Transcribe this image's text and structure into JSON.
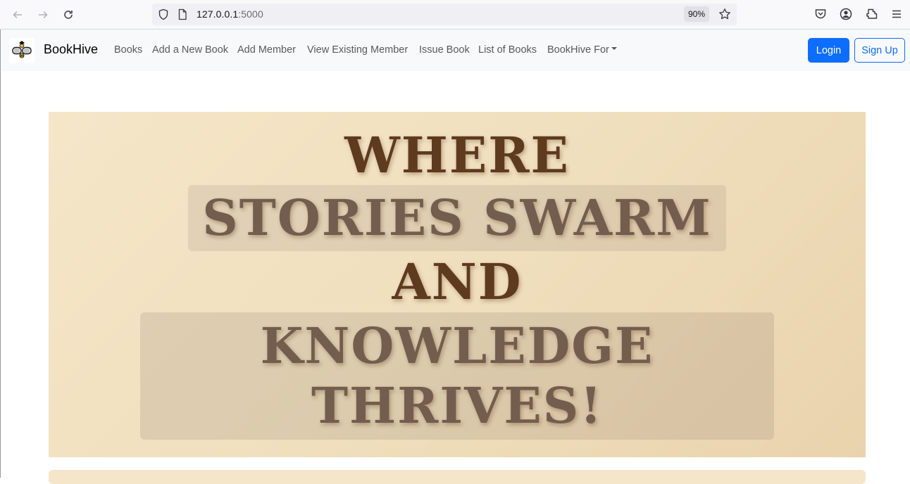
{
  "browser": {
    "url_host": "127.0.0.1",
    "url_port": ":5000",
    "zoom": "90%",
    "icons": [
      "back-icon",
      "forward-icon",
      "reload-icon",
      "shield-icon",
      "page-icon",
      "star-icon",
      "pocket-icon",
      "account-icon",
      "extensions-icon",
      "menu-icon"
    ]
  },
  "navbar": {
    "brand": "BookHive",
    "links": [
      "Books",
      "Add a New Book",
      "Add Member",
      "View Existing Member",
      "Issue Book",
      "List of Books",
      "BookHive For"
    ],
    "login": "Login",
    "signup": "Sign Up"
  },
  "hero": {
    "line1": "WHERE",
    "line2": "STORIES SWARM",
    "line3": "AND",
    "line4": "KNOWLEDGE",
    "line5": "THRIVES!"
  },
  "colors": {
    "primary": "#0d6efd",
    "hero_bg": "#f0dfbd",
    "hero_text_dark": "#5e3a1f",
    "hero_text_muted": "#735d4e"
  }
}
